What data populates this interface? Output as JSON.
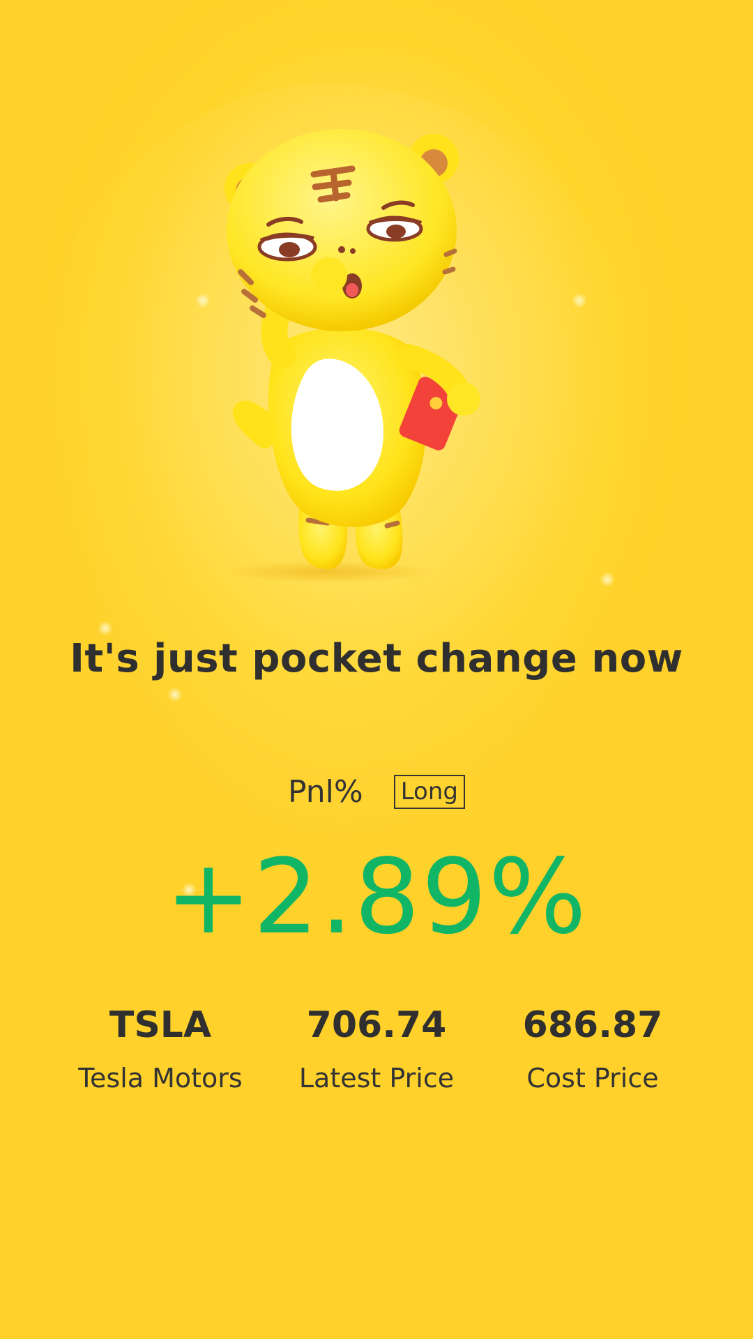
{
  "headline": "It's just pocket change now",
  "pnl": {
    "label": "Pnl%",
    "direction": "Long",
    "value": "+2.89%",
    "value_color": "#11b566"
  },
  "stats": [
    {
      "value": "TSLA",
      "label": "Tesla Motors"
    },
    {
      "value": "706.74",
      "label": "Latest Price"
    },
    {
      "value": "686.87",
      "label": "Cost Price"
    }
  ],
  "colors": {
    "background": "#ffd52c",
    "text": "#333333"
  },
  "illustration": "tiger-mascot-holding-red-envelope"
}
